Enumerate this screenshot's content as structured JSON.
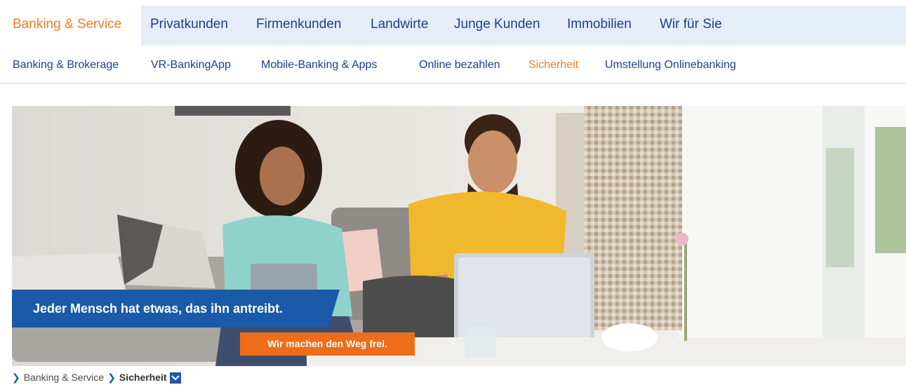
{
  "primary_nav": {
    "items": [
      {
        "label": "Banking & Service",
        "active": true
      },
      {
        "label": "Privatkunden"
      },
      {
        "label": "Firmenkunden"
      },
      {
        "label": "Landwirte"
      },
      {
        "label": "Junge Kunden"
      },
      {
        "label": "Immobilien"
      },
      {
        "label": "Wir für Sie"
      }
    ]
  },
  "secondary_nav": {
    "items": [
      {
        "label": "Banking & Brokerage"
      },
      {
        "label": "VR-BankingApp"
      },
      {
        "label": "Mobile-Banking & Apps"
      },
      {
        "label": "Online bezahlen"
      },
      {
        "label": "Sicherheit",
        "active": true
      },
      {
        "label": "Umstellung Onlinebanking"
      }
    ]
  },
  "hero": {
    "claim": "Jeder Mensch hat etwas, das ihn antreibt.",
    "slogan": "Wir machen den Weg frei."
  },
  "breadcrumb": {
    "items": [
      "Banking & Service",
      "Sicherheit"
    ],
    "chevron_icon": "chevron-right-icon",
    "dropdown_icon": "chevron-down-icon"
  },
  "colors": {
    "accent_orange": "#ef7b22",
    "brand_blue": "#1a5aa8",
    "nav_text": "#1e3d8f",
    "nav_bar_bg": "#e5eef8"
  }
}
